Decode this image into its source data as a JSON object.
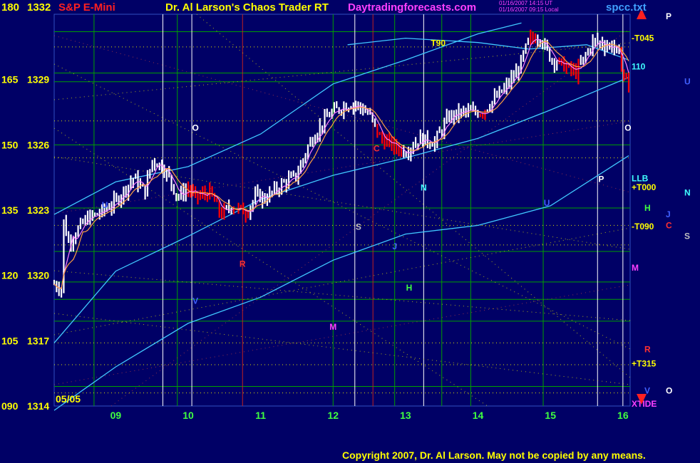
{
  "header": {
    "price_scale_top": "180",
    "price_top": "1332",
    "instrument": "S&P E-Mini",
    "title": "Dr. Al Larson's Chaos Trader RT",
    "site": "Daytradingforecasts.com",
    "stamp_line1": "01/16/2007 14:15 UT",
    "stamp_line2": "01/16/2007 09:15 Local",
    "filename": "spcc.txt"
  },
  "copyright": "Copyright 2007, Dr. Al Larson. May not be copied by any means.",
  "colors": {
    "background": "#000066",
    "grid_green": "#00a000",
    "header_yellow": "#ffff00",
    "header_red": "#ff2020",
    "header_magenta": "#ff40ff",
    "bands_cyan": "#40c8ff",
    "bar_white": "#ffffff",
    "bar_red": "#ff0000",
    "ma_magenta": "#ff80ff",
    "ma_orange": "#ffa040",
    "harmonic_yellow": "#e0e000",
    "grid_label_green": "#40ff40"
  },
  "chart_data": {
    "type": "candlestick",
    "date_start_label": "05/05",
    "x_ticks": [
      "09",
      "10",
      "11",
      "12",
      "13",
      "14",
      "15",
      "16"
    ],
    "y_ticks": [
      {
        "scale": "180",
        "price": "1332",
        "value": 1332
      },
      {
        "scale": "165",
        "price": "1329",
        "value": 1329
      },
      {
        "scale": "150",
        "price": "1326",
        "value": 1326
      },
      {
        "scale": "135",
        "price": "1323",
        "value": 1323
      },
      {
        "scale": "120",
        "price": "1320",
        "value": 1320
      },
      {
        "scale": "105",
        "price": "1317",
        "value": 1317
      },
      {
        "scale": "090",
        "price": "1314",
        "value": 1314
      }
    ],
    "ylim": [
      1314,
      1332
    ],
    "xlim": [
      8.15,
      16.1
    ],
    "grid": true,
    "price_path": [
      [
        8.15,
        1319.6
      ],
      [
        8.25,
        1319.4
      ],
      [
        8.28,
        1322.5
      ],
      [
        8.35,
        1321.5
      ],
      [
        8.45,
        1322.0
      ],
      [
        8.6,
        1322.6
      ],
      [
        8.8,
        1322.9
      ],
      [
        9.0,
        1323.4
      ],
      [
        9.25,
        1324.5
      ],
      [
        9.4,
        1323.8
      ],
      [
        9.5,
        1325.3
      ],
      [
        9.65,
        1325.0
      ],
      [
        9.75,
        1324.4
      ],
      [
        9.85,
        1323.6
      ],
      [
        10.0,
        1324.0
      ],
      [
        10.1,
        1323.6
      ],
      [
        10.3,
        1323.8
      ],
      [
        10.45,
        1322.8
      ],
      [
        10.6,
        1323.2
      ],
      [
        10.8,
        1322.9
      ],
      [
        10.95,
        1323.7
      ],
      [
        11.05,
        1323.5
      ],
      [
        11.3,
        1324.2
      ],
      [
        11.5,
        1324.6
      ],
      [
        11.65,
        1325.9
      ],
      [
        11.75,
        1326.5
      ],
      [
        11.95,
        1327.4
      ],
      [
        12.15,
        1327.8
      ],
      [
        12.3,
        1327.9
      ],
      [
        12.5,
        1327.4
      ],
      [
        12.65,
        1326.3
      ],
      [
        12.8,
        1326.0
      ],
      [
        13.0,
        1325.7
      ],
      [
        13.2,
        1326.3
      ],
      [
        13.4,
        1326.1
      ],
      [
        13.6,
        1327.3
      ],
      [
        13.8,
        1327.5
      ],
      [
        14.05,
        1327.5
      ],
      [
        14.35,
        1328.5
      ],
      [
        14.55,
        1329.4
      ],
      [
        14.7,
        1330.8
      ],
      [
        14.85,
        1331.0
      ],
      [
        15.0,
        1330.0
      ],
      [
        15.2,
        1329.6
      ],
      [
        15.35,
        1329.3
      ],
      [
        15.5,
        1330.2
      ],
      [
        15.6,
        1330.8
      ],
      [
        15.75,
        1330.6
      ],
      [
        15.9,
        1330.5
      ],
      [
        16.0,
        1329.4
      ],
      [
        16.08,
        1328.7
      ]
    ],
    "red_segments": [
      [
        10.0,
        10.5
      ],
      [
        10.6,
        10.85
      ],
      [
        12.6,
        12.95
      ],
      [
        14.0,
        14.1
      ],
      [
        14.7,
        14.8
      ],
      [
        15.1,
        15.4
      ],
      [
        15.95,
        16.08
      ]
    ],
    "bands": [
      {
        "name": "upper",
        "points": [
          [
            8.15,
            1322.8
          ],
          [
            9.0,
            1324.3
          ],
          [
            10.0,
            1325.0
          ],
          [
            11.0,
            1326.5
          ],
          [
            12.0,
            1328.8
          ],
          [
            13.0,
            1329.9
          ],
          [
            14.0,
            1331.1
          ],
          [
            14.6,
            1331.6
          ]
        ]
      },
      {
        "name": "upper-mid",
        "points": [
          [
            12.2,
            1330.6
          ],
          [
            13.0,
            1330.9
          ],
          [
            14.0,
            1330.7
          ],
          [
            14.7,
            1330.4
          ],
          [
            15.5,
            1330.6
          ],
          [
            16.08,
            1329.9
          ]
        ]
      },
      {
        "name": "lower-mid",
        "points": [
          [
            8.15,
            1316.9
          ],
          [
            9.0,
            1320.2
          ],
          [
            10.0,
            1321.8
          ],
          [
            11.0,
            1323.5
          ],
          [
            12.0,
            1324.6
          ],
          [
            13.0,
            1325.4
          ],
          [
            14.0,
            1326.3
          ],
          [
            15.0,
            1327.6
          ],
          [
            16.08,
            1329.1
          ]
        ]
      },
      {
        "name": "lower",
        "points": [
          [
            8.15,
            1313.8
          ],
          [
            9.0,
            1315.8
          ],
          [
            10.0,
            1317.8
          ],
          [
            11.0,
            1319.0
          ],
          [
            12.0,
            1320.7
          ],
          [
            13.0,
            1321.9
          ],
          [
            14.0,
            1322.3
          ],
          [
            15.0,
            1323.2
          ],
          [
            16.08,
            1325.5
          ]
        ]
      }
    ],
    "white_vlines": [
      9.65,
      10.05,
      12.3,
      13.25,
      15.65,
      16.0
    ],
    "green_vlines": [
      8.7,
      9.85,
      12.0,
      12.85,
      13.5,
      13.9,
      14.9
    ],
    "red_vlines": [
      10.75,
      12.55
    ],
    "hlines": [
      1331.2,
      1329.3,
      1328.9,
      1326.0,
      1323.1,
      1321.1,
      1319.7,
      1318.9,
      1317.9,
      1314.9
    ],
    "dotted_levels": [
      1330.5,
      1327.1,
      1325.4,
      1322.3,
      1321.4,
      1316.9,
      1315.9,
      1314.6
    ],
    "chart_markers": [
      {
        "text": "T90",
        "x": 13.45,
        "y": 1330.55,
        "color": "#ffff00"
      },
      {
        "text": "O",
        "x": 10.1,
        "y": 1326.65,
        "color": "#ffffff"
      },
      {
        "text": "N",
        "x": 13.25,
        "y": 1323.9,
        "color": "#40ffff"
      },
      {
        "text": "U",
        "x": 8.85,
        "y": 1323.1,
        "color": "#4060ff"
      },
      {
        "text": "C",
        "x": 12.6,
        "y": 1325.7,
        "color": "#ff3030"
      },
      {
        "text": "S",
        "x": 12.35,
        "y": 1322.1,
        "color": "#c0c0c0"
      },
      {
        "text": "J",
        "x": 12.85,
        "y": 1321.2,
        "color": "#4060ff"
      },
      {
        "text": "R",
        "x": 10.75,
        "y": 1320.4,
        "color": "#ff3030"
      },
      {
        "text": "H",
        "x": 13.05,
        "y": 1319.3,
        "color": "#40ff40"
      },
      {
        "text": "V",
        "x": 10.1,
        "y": 1318.7,
        "color": "#4060ff"
      },
      {
        "text": "M",
        "x": 12.0,
        "y": 1317.5,
        "color": "#ff40ff"
      },
      {
        "text": "U",
        "x": 14.95,
        "y": 1323.2,
        "color": "#4060ff"
      },
      {
        "text": "P",
        "x": 15.7,
        "y": 1324.3,
        "color": "#ffffff"
      },
      {
        "text": "O",
        "x": 16.07,
        "y": 1326.65,
        "color": "#ffffff"
      }
    ],
    "right_labels": [
      {
        "text": "-T045",
        "y": 1330.9,
        "color": "#ffff00",
        "col": 0
      },
      {
        "text": "110",
        "y": 1329.6,
        "color": "#40ffff",
        "col": 0
      },
      {
        "text": "LLB",
        "y": 1324.45,
        "color": "#40ffff",
        "col": 0
      },
      {
        "text": "+T000",
        "y": 1324.05,
        "color": "#ffff00",
        "col": 0
      },
      {
        "text": "-T090",
        "y": 1322.25,
        "color": "#ffff00",
        "col": 0
      },
      {
        "text": "M",
        "y": 1320.35,
        "color": "#ff40ff",
        "col": 0
      },
      {
        "text": "+T315",
        "y": 1315.95,
        "color": "#ffff00",
        "col": 0
      },
      {
        "text": "XTIDE",
        "y": 1314.1,
        "color": "#ff40ff",
        "col": 0
      },
      {
        "text": "P",
        "y": 1331.9,
        "color": "#ffffff",
        "col": 2
      },
      {
        "text": "U",
        "y": 1328.9,
        "color": "#4060ff",
        "col": 3
      },
      {
        "text": "N",
        "y": 1323.8,
        "color": "#40ffff",
        "col": 3
      },
      {
        "text": "H",
        "y": 1323.1,
        "color": "#40ff40",
        "col": 1
      },
      {
        "text": "J",
        "y": 1322.8,
        "color": "#4060ff",
        "col": 2
      },
      {
        "text": "C",
        "y": 1322.3,
        "color": "#ff3030",
        "col": 2
      },
      {
        "text": "S",
        "y": 1321.8,
        "color": "#c0c0c0",
        "col": 3
      },
      {
        "text": "R",
        "y": 1316.6,
        "color": "#ff3030",
        "col": 1
      },
      {
        "text": "O",
        "y": 1314.7,
        "color": "#ffffff",
        "col": 2
      },
      {
        "text": "V",
        "y": 1314.7,
        "color": "#4060ff",
        "col": 1
      }
    ]
  }
}
